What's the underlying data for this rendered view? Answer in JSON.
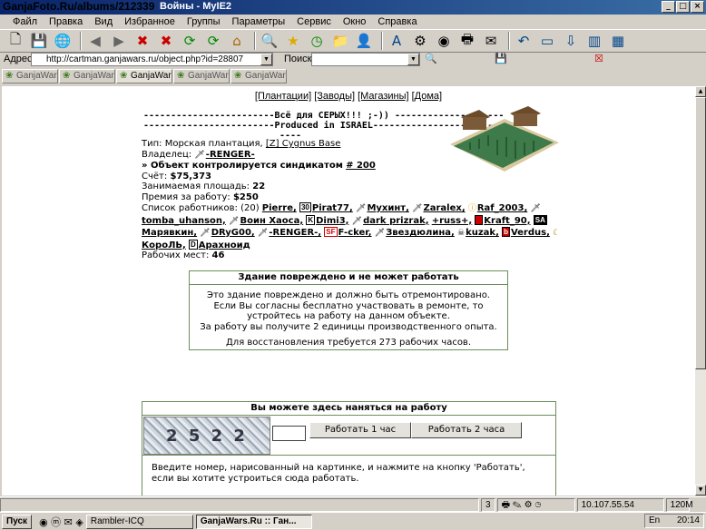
{
  "watermark": "GanjaFoto.Ru/albums/212339",
  "window": {
    "title": "Войны - MyIE2"
  },
  "menu": [
    "Файл",
    "Правка",
    "Вид",
    "Избранное",
    "Группы",
    "Параметры",
    "Сервис",
    "Окно",
    "Справка"
  ],
  "address": {
    "label": "Адрес",
    "url": "http://cartman.ganjawars.ru/object.php?id=28807",
    "search_label": "Поиск"
  },
  "tabs": [
    "GanjaWar...",
    "GanjaWar...",
    "GanjaWar...",
    "GanjaWar...",
    "GanjaWar..."
  ],
  "nav": {
    "plantations": "[Плантации]",
    "factories": "[Заводы]",
    "shops": "[Магазины]",
    "houses": "[Дома]"
  },
  "banner": {
    "line1": "------------------------Всё для СЕРЫХ!!! ;-)) --------------------",
    "line2": "------------------------Produced in ISRAEL------------------------",
    "line3": "----"
  },
  "object": {
    "type_label": "Тип: Морская плантация,",
    "type_link": "[Z] Cygnus Base",
    "owner_label": "Владелец:",
    "owner": "-RENGER-",
    "syndicate_text": "» Объект контролируется синдикатом",
    "syndicate_link": "# 200",
    "account_label": "Счёт:",
    "account": "$75,373",
    "area_label": "Занимаемая площадь:",
    "area": "22",
    "premium_label": "Премия за работу:",
    "premium": "$250",
    "workers_label": "Список работников: (20)",
    "workers": [
      "Pierre,",
      "Pirat77,",
      "Мухинт,",
      "Zaralex,",
      "Raf_2003,",
      "tomba_uhanson,",
      "Воин Хаоса,",
      "Dimi3,",
      "dark prizrak,",
      "+russ+,",
      "Kraft_90,",
      "Марявкин,",
      "DRyG00,",
      "-RENGER-,",
      "F-cker,",
      "Звездюлина,",
      "kuzak,",
      "Verdus,",
      "КороЛЬ,",
      "Арахноид"
    ],
    "places_label": "Рабочих мест:",
    "places": "46"
  },
  "damage": {
    "title": "Здание повреждено и не может работать",
    "text1": "Это здание повреждено и должно быть отремонтировано.",
    "text2": "Если Вы согласны бесплатно участвовать в ремонте, то",
    "text3": "устройтесь на работу на данном объекте.",
    "text4": "За работу вы получите 2 единицы производственного опыта.",
    "text5": "Для восстановления требуется 273 рабочих часов."
  },
  "hire": {
    "title": "Вы можете здесь наняться на работу",
    "captcha": "2 5 2 2",
    "btn1": "Работать 1 час",
    "btn2": "Работать 2 часа",
    "msg1": "Введите номер, нарисованный на картинке, и нажмите на кнопку 'Работать',",
    "msg2": "если вы хотите устроиться сюда работать."
  },
  "status": {
    "count": "3",
    "ip": "10.107.55.54",
    "mem": "120M"
  },
  "taskbar": {
    "start": "Пуск",
    "task1": "Rambler-ICQ",
    "task2": "GanjaWars.Ru :: Ган...",
    "lang": "En",
    "time": "20:14"
  }
}
